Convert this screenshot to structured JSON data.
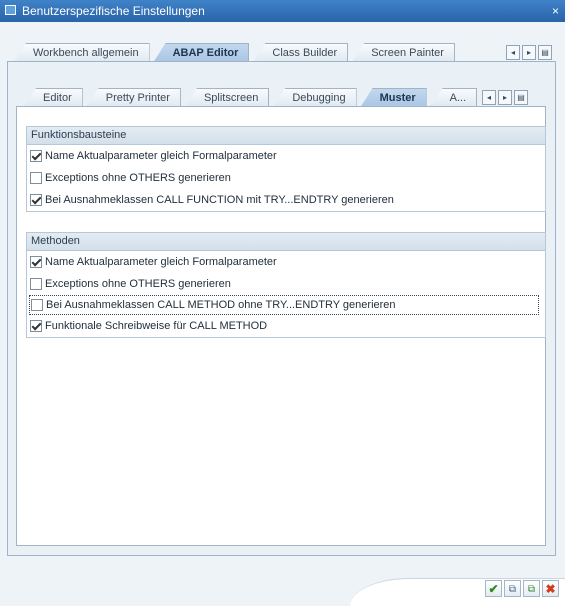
{
  "window": {
    "title": "Benutzerspezifische Einstellungen",
    "close_glyph": "×"
  },
  "main_tabs": [
    {
      "label": "Workbench allgemein",
      "active": false
    },
    {
      "label": "ABAP Editor",
      "active": true
    },
    {
      "label": "Class Builder",
      "active": false
    },
    {
      "label": "Screen Painter",
      "active": false
    }
  ],
  "sub_tabs": [
    {
      "label": "Editor",
      "active": false
    },
    {
      "label": "Pretty Printer",
      "active": false
    },
    {
      "label": "Splitscreen",
      "active": false
    },
    {
      "label": "Debugging",
      "active": false
    },
    {
      "label": "Muster",
      "active": true
    },
    {
      "label": "A...",
      "active": false
    }
  ],
  "nav_buttons": {
    "left": "◂",
    "right": "▸",
    "list": "▤"
  },
  "groups": {
    "funktionsbausteine": {
      "title": "Funktionsbausteine",
      "options": [
        {
          "label": "Name Aktualparameter gleich Formalparameter",
          "checked": true
        },
        {
          "label": "Exceptions ohne OTHERS generieren",
          "checked": false
        },
        {
          "label": "Bei Ausnahmeklassen CALL FUNCTION mit TRY...ENDTRY generieren",
          "checked": true
        }
      ]
    },
    "methoden": {
      "title": "Methoden",
      "options": [
        {
          "label": "Name Aktualparameter gleich Formalparameter",
          "checked": true
        },
        {
          "label": "Exceptions ohne OTHERS generieren",
          "checked": false
        },
        {
          "label": "Bei Ausnahmeklassen CALL METHOD ohne TRY...ENDTRY generieren",
          "checked": false
        },
        {
          "label": "Funktionale Schreibweise für CALL METHOD",
          "checked": true
        }
      ]
    }
  },
  "footer_buttons": {
    "ok": "✔",
    "copy": "⧉",
    "copy2": "⧉",
    "cancel": "✖"
  },
  "colors": {
    "titlebar": "#2a63a8",
    "active_tab": "#a9c6e4",
    "ok": "#2e8b1e",
    "cancel": "#d23a1c"
  }
}
